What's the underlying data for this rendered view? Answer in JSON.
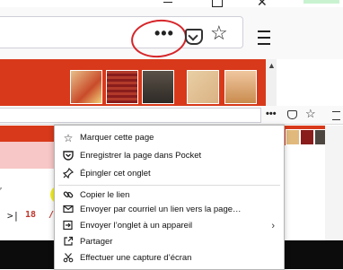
{
  "menu": {
    "items": [
      {
        "label": "Marquer cette page",
        "icon": "star-icon"
      },
      {
        "label": "Enregistrer la page dans Pocket",
        "icon": "pocket-icon"
      },
      {
        "label": "Épingler cet onglet",
        "icon": "pin-icon"
      },
      {
        "label": "Copier le lien",
        "icon": "link-icon"
      },
      {
        "label": "Envoyer par courriel un lien vers la page…",
        "icon": "email-icon"
      },
      {
        "label": "Envoyer l’onglet à un appareil",
        "icon": "send-tab-icon"
      },
      {
        "label": "Partager",
        "icon": "share-icon"
      },
      {
        "label": "Effectuer une capture d’écran",
        "icon": "screenshot-icon"
      }
    ],
    "submenu_indicator": "›"
  },
  "toolbar": {
    "page_actions_label": "•••",
    "bookmark_star": "☆",
    "close_glyph": "✕"
  },
  "page_fragment": {
    "bracket": ">|",
    "number": "18",
    "slash": "/"
  },
  "colors": {
    "accent_red": "#d8391a",
    "annotation_circle": "#d6262a",
    "highlight": "#f4f024"
  }
}
